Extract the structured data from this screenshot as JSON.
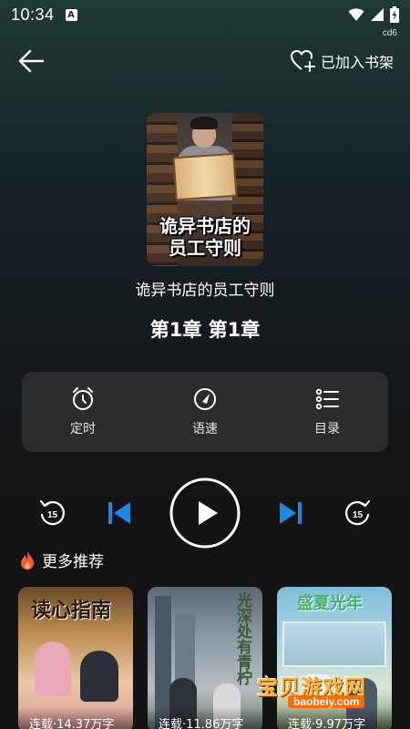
{
  "status_bar": {
    "time": "10:34",
    "notification_letter": "A",
    "device_tag": "cd6"
  },
  "topbar": {
    "back_icon": "arrow-left-icon",
    "shelf_icon": "heart-plus-icon",
    "shelf_label": "已加入书架"
  },
  "book": {
    "cover_title_line1": "诡异书店的",
    "cover_title_line2": "员工守则",
    "title": "诡异书店的员工守则",
    "chapter": "第1章  第1章"
  },
  "controls": [
    {
      "icon": "alarm-clock-icon",
      "label": "定时"
    },
    {
      "icon": "speed-gauge-icon",
      "label": "语速"
    },
    {
      "icon": "list-icon",
      "label": "目录"
    }
  ],
  "player": {
    "rewind_seconds": "15",
    "forward_seconds": "15",
    "accent_color": "#1e88e5"
  },
  "recommend": {
    "header_icon": "fire-icon",
    "header": "更多推荐",
    "items": [
      {
        "art_title": "读心指南",
        "status": "连载·14.37万字"
      },
      {
        "art_title": "光深处有青柠",
        "status": "连载·11.86万字"
      },
      {
        "art_title": "盛夏光年",
        "status": "连载·9.97万字"
      }
    ]
  },
  "watermark": {
    "title": "宝贝游戏网",
    "url": "baobeiy.com"
  }
}
